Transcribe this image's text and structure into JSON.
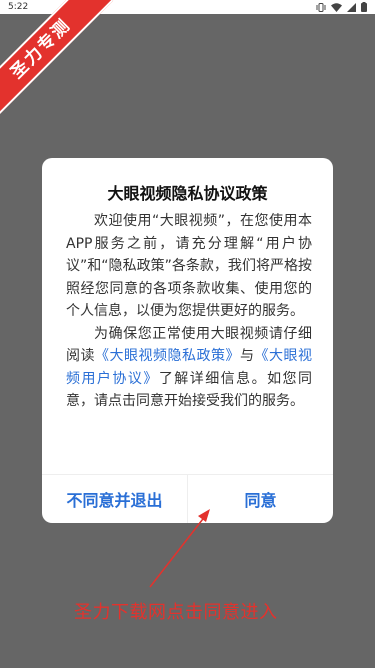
{
  "status": {
    "time": "5:22"
  },
  "watermark": {
    "ribbon_text": "圣力专测"
  },
  "dialog": {
    "title": "大眼视频隐私协议政策",
    "paragraph1": "欢迎使用“大眼视频”，在您使用本APP服务之前，请充分理解“用户协议”和“隐私政策”各条款，我们将严格按照经您同意的各项条款收集、使用您的个人信息，以便为您提供更好的服务。",
    "p2_before": "为确保您正常使用大眼视频请仔细阅读",
    "privacy_link": "《大眼视频隐私政策》",
    "p2_and": "与",
    "user_agreement_link": "《大眼视频用户协议》",
    "p2_after": "了解详细信息。如您同意，请点击同意开始接受我们的服务。",
    "decline_label": "不同意并退出",
    "agree_label": "同意"
  },
  "annotation": {
    "text": "圣力下载网点击同意进入"
  },
  "colors": {
    "accent": "#2a6fd6",
    "ribbon": "#e3322d",
    "overlay": "#666666"
  }
}
